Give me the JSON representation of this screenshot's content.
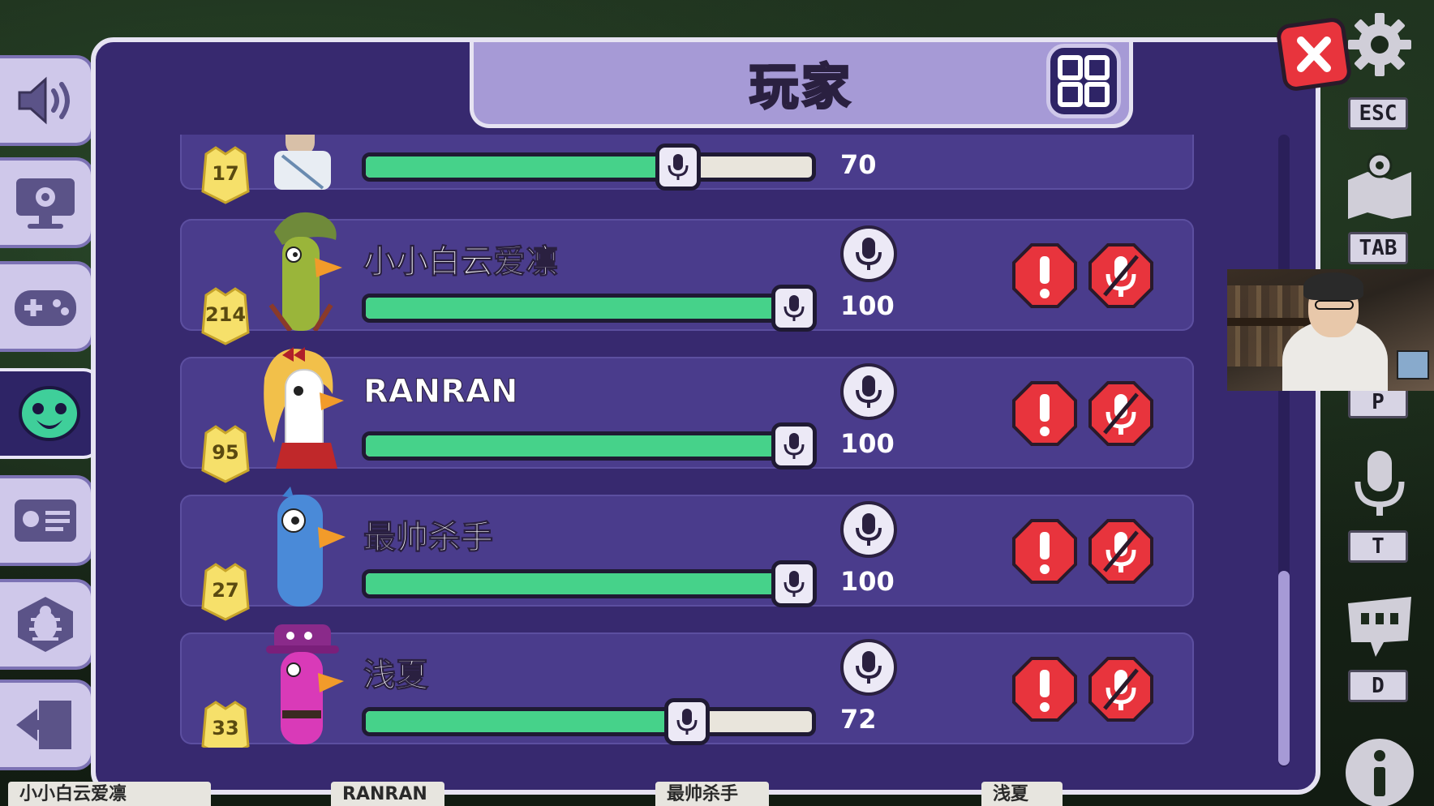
{
  "header": {
    "title": "玩家"
  },
  "right_keys": {
    "esc": "ESC",
    "tab": "TAB",
    "p": "P",
    "t": "T",
    "d": "D"
  },
  "players": [
    {
      "level": "17",
      "name": "",
      "volume_label": "70",
      "volume": 0.7,
      "color": "#d9d9d9"
    },
    {
      "level": "214",
      "name": "小小白云爱凛",
      "volume_label": "100",
      "volume": 1.0
    },
    {
      "level": "95",
      "name": "RANRAN",
      "volume_label": "100",
      "volume": 1.0
    },
    {
      "level": "27",
      "name": "最帅杀手",
      "volume_label": "100",
      "volume": 1.0
    },
    {
      "level": "33",
      "name": "浅夏",
      "volume_label": "72",
      "volume": 0.72
    }
  ],
  "bottom_names": [
    "小小白云爱凛",
    "RANRAN",
    "最帅杀手",
    "浅夏"
  ],
  "colors": {
    "panel": "#37296f",
    "row": "#4a3c8c",
    "slider_fill": "#46d28a",
    "danger": "#e8343d",
    "badge": "#f6e06a"
  }
}
